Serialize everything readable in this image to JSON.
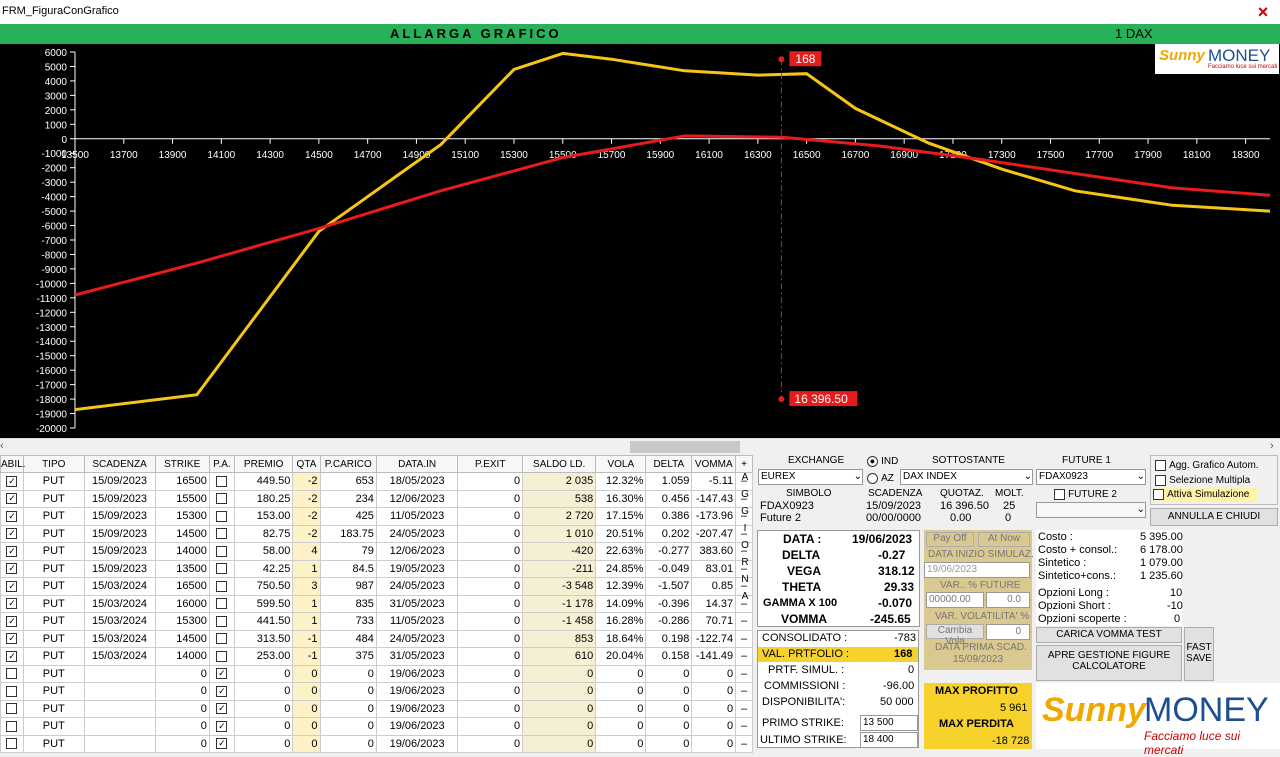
{
  "window": {
    "title": "FRM_FiguraConGrafico"
  },
  "header": {
    "title": "ALLARGA GRAFICO",
    "right": "1 DAX"
  },
  "logo": {
    "sunny": "Sunny",
    "money": "MONEY",
    "claim": "Facciamo luce sui mercati"
  },
  "chart_data": {
    "type": "line",
    "xlim": [
      13500,
      18400
    ],
    "ylim": [
      -20000,
      6000
    ],
    "x_ticks": [
      "13500",
      "13700",
      "13900",
      "14100",
      "14300",
      "14500",
      "14700",
      "14900",
      "15100",
      "15300",
      "15500",
      "15700",
      "15900",
      "16100",
      "16300",
      "16500",
      "16700",
      "16900",
      "17100",
      "17300",
      "17500",
      "17700",
      "17900",
      "18100",
      "18300"
    ],
    "y_ticks": [
      "6000",
      "5000",
      "4000",
      "3000",
      "2000",
      "1000",
      "0",
      "-1000",
      "-2000",
      "-3000",
      "-4000",
      "-5000",
      "-6000",
      "-7000",
      "-8000",
      "-9000",
      "-10000",
      "-11000",
      "-12000",
      "-13000",
      "-14000",
      "-15000",
      "-16000",
      "-17000",
      "-18000",
      "-19000",
      "-20000"
    ],
    "series": [
      {
        "color": "#f5c518",
        "points": [
          [
            13500,
            -18728
          ],
          [
            14000,
            -17700
          ],
          [
            14500,
            -6400
          ],
          [
            15000,
            -400
          ],
          [
            15300,
            4800
          ],
          [
            15500,
            5900
          ],
          [
            15700,
            5500
          ],
          [
            16000,
            4700
          ],
          [
            16300,
            4400
          ],
          [
            16500,
            4500
          ],
          [
            16700,
            2100
          ],
          [
            17000,
            -300
          ],
          [
            17300,
            -2100
          ],
          [
            17600,
            -3600
          ],
          [
            18000,
            -4600
          ],
          [
            18400,
            -5000
          ]
        ]
      },
      {
        "color": "#e61b1b",
        "points": [
          [
            13500,
            -10800
          ],
          [
            14000,
            -8600
          ],
          [
            14500,
            -6200
          ],
          [
            15000,
            -3600
          ],
          [
            15500,
            -1300
          ],
          [
            16000,
            200
          ],
          [
            16400,
            100
          ],
          [
            16800,
            -500
          ],
          [
            17200,
            -1400
          ],
          [
            17600,
            -2400
          ],
          [
            18000,
            -3400
          ],
          [
            18400,
            -3900
          ]
        ]
      }
    ],
    "marker": {
      "x": 16396.5,
      "label_top": "168",
      "label_bottom": "16 396.50"
    },
    "grid": false
  },
  "table": {
    "columns": [
      "ABIL.",
      "TIPO",
      "SCADENZA",
      "STRIKE",
      "P.A.",
      "PREMIO",
      "QTA",
      "P.CARICO",
      "DATA.IN",
      "P.EXIT",
      "SALDO LD.",
      "VOLA",
      "DELTA",
      "VOMMA",
      "+"
    ],
    "rows": [
      [
        "✓",
        "PUT",
        "15/09/2023",
        "16500",
        "",
        "449.50",
        "-2",
        "653",
        "18/05/2023",
        "0",
        "2 035",
        "12.32%",
        "1.059",
        "-5.11"
      ],
      [
        "✓",
        "PUT",
        "15/09/2023",
        "15500",
        "",
        "180.25",
        "-2",
        "234",
        "12/06/2023",
        "0",
        "538",
        "16.30%",
        "0.456",
        "-147.43"
      ],
      [
        "✓",
        "PUT",
        "15/09/2023",
        "15300",
        "",
        "153.00",
        "-2",
        "425",
        "11/05/2023",
        "0",
        "2 720",
        "17.15%",
        "0.386",
        "-173.96"
      ],
      [
        "✓",
        "PUT",
        "15/09/2023",
        "14500",
        "",
        "82.75",
        "-2",
        "183.75",
        "24/05/2023",
        "0",
        "1 010",
        "20.51%",
        "0.202",
        "-207.47"
      ],
      [
        "✓",
        "PUT",
        "15/09/2023",
        "14000",
        "",
        "58.00",
        "4",
        "79",
        "12/06/2023",
        "0",
        "-420",
        "22.63%",
        "-0.277",
        "383.60"
      ],
      [
        "✓",
        "PUT",
        "15/09/2023",
        "13500",
        "",
        "42.25",
        "1",
        "84.5",
        "19/05/2023",
        "0",
        "-211",
        "24.85%",
        "-0.049",
        "83.01"
      ],
      [
        "✓",
        "PUT",
        "15/03/2024",
        "16500",
        "",
        "750.50",
        "3",
        "987",
        "24/05/2023",
        "0",
        "-3 548",
        "12.39%",
        "-1.507",
        "0.85"
      ],
      [
        "✓",
        "PUT",
        "15/03/2024",
        "16000",
        "",
        "599.50",
        "1",
        "835",
        "31/05/2023",
        "0",
        "-1 178",
        "14.09%",
        "-0.396",
        "14.37"
      ],
      [
        "✓",
        "PUT",
        "15/03/2024",
        "15300",
        "",
        "441.50",
        "1",
        "733",
        "11/05/2023",
        "0",
        "-1 458",
        "16.28%",
        "-0.286",
        "70.71"
      ],
      [
        "✓",
        "PUT",
        "15/03/2024",
        "14500",
        "",
        "313.50",
        "-1",
        "484",
        "24/05/2023",
        "0",
        "853",
        "18.64%",
        "0.198",
        "-122.74"
      ],
      [
        "✓",
        "PUT",
        "15/03/2024",
        "14000",
        "",
        "253.00",
        "-1",
        "375",
        "31/05/2023",
        "0",
        "610",
        "20.04%",
        "0.158",
        "-141.49"
      ],
      [
        "",
        "PUT",
        "",
        "0",
        "✓",
        "0",
        "0",
        "0",
        "19/06/2023",
        "0",
        "0",
        "0",
        "0",
        "0"
      ],
      [
        "",
        "PUT",
        "",
        "0",
        "✓",
        "0",
        "0",
        "0",
        "19/06/2023",
        "0",
        "0",
        "0",
        "0",
        "0"
      ],
      [
        "",
        "PUT",
        "",
        "0",
        "✓",
        "0",
        "0",
        "0",
        "19/06/2023",
        "0",
        "0",
        "0",
        "0",
        "0"
      ],
      [
        "",
        "PUT",
        "",
        "0",
        "✓",
        "0",
        "0",
        "0",
        "19/06/2023",
        "0",
        "0",
        "0",
        "0",
        "0"
      ],
      [
        "",
        "PUT",
        "",
        "0",
        "✓",
        "0",
        "0",
        "0",
        "19/06/2023",
        "0",
        "0",
        "0",
        "0",
        "0"
      ]
    ],
    "row_btn": "–",
    "aggiorna": [
      "A",
      "G",
      "G",
      "I",
      "O",
      "R",
      "N",
      "A"
    ]
  },
  "exchange": {
    "exchange_label": "EXCHANGE",
    "ind": "IND",
    "az": "AZ",
    "sottostante_label": "SOTTOSTANTE",
    "future1_label": "FUTURE 1",
    "exchange_val": "EUREX",
    "sottostante_val": "DAX INDEX",
    "future1_val": "FDAX0923",
    "simbolo_label": "SIMBOLO",
    "scadenza_label": "SCADENZA",
    "quotaz_label": "QUOTAZ.",
    "molt_label": "MOLT.",
    "future2_label": "FUTURE 2",
    "row1": [
      "FDAX0923",
      "15/09/2023",
      "16 396.50",
      "25"
    ],
    "row2": [
      "Future 2",
      "00/00/0000",
      "0.00",
      "0"
    ]
  },
  "options": {
    "agg": "Agg. Grafico Autom.",
    "sel": "Selezione Multipla",
    "sim": "Attiva Simulazione",
    "annulla": "ANNULLA E CHIUDI"
  },
  "greeks": {
    "data_label": "DATA :",
    "data_val": "19/06/2023",
    "delta_label": "DELTA",
    "delta_val": "-0.27",
    "vega_label": "VEGA",
    "vega_val": "318.12",
    "theta_label": "THETA",
    "theta_val": "29.33",
    "gamma_label": "GAMMA X 100",
    "gamma_val": "-0.070",
    "vomma_label": "VOMMA",
    "vomma_val": "-245.65"
  },
  "sim": {
    "payoff": "Pay Off",
    "atnow": "At Now",
    "data_inizio": "DATA INIZIO SIMULAZ.",
    "data_inizio_val": "19/06/2023",
    "var_future": "VAR.. % FUTURE",
    "var_future_val": "00000.00",
    "var_future_pct": "0.0",
    "var_vola": "VAR. VOLATILITA' %",
    "cambia_vola": "Cambia Vola",
    "vola_val": "0",
    "prima_scad": "DATA PRIMA SCAD.",
    "prima_scad_val": "15/09/2023"
  },
  "portfolio": {
    "consolidato_label": "CONSOLIDATO :",
    "consolidato_val": "-783",
    "val_label": "VAL. PRTFOLIO :",
    "val_val": "168",
    "simul_label": "PRTF. SIMUL. :",
    "simul_val": "0",
    "comm_label": "COMMISSIONI :",
    "comm_val": "-96.00",
    "disp_label": "DISPONIBILITA':",
    "disp_val": "50 000",
    "primo_label": "PRIMO STRIKE:",
    "primo_val": "13 500",
    "ultimo_label": "ULTIMO STRIKE:",
    "ultimo_val": "18 400",
    "maxp_label": "MAX PROFITTO",
    "maxp_val": "5 961",
    "maxl_label": "MAX PERDITA",
    "maxl_val": "-18 728"
  },
  "costs": {
    "costo_label": "Costo :",
    "costo_val": "5 395.00",
    "costoc_label": "Costo + consol.:",
    "costoc_val": "6 178.00",
    "sint_label": "Sintetico :",
    "sint_val": "1 079.00",
    "sintc_label": "Sintetico+cons.:",
    "sintc_val": "1 235.60",
    "long_label": "Opzioni Long :",
    "long_val": "10",
    "short_label": "Opzioni Short :",
    "short_val": "-10",
    "scop_label": "Opzioni scoperte :",
    "scop_val": "0",
    "vomma_btn": "CARICA VOMMA TEST",
    "apre_btn": "APRE GESTIONE FIGURE CALCOLATORE",
    "fast_btn": "FAST SAVE"
  },
  "colors": {
    "green": "#29b05b",
    "yellow": "#f8d22c",
    "red": "#e61b1b",
    "gold": "#f5c518"
  }
}
